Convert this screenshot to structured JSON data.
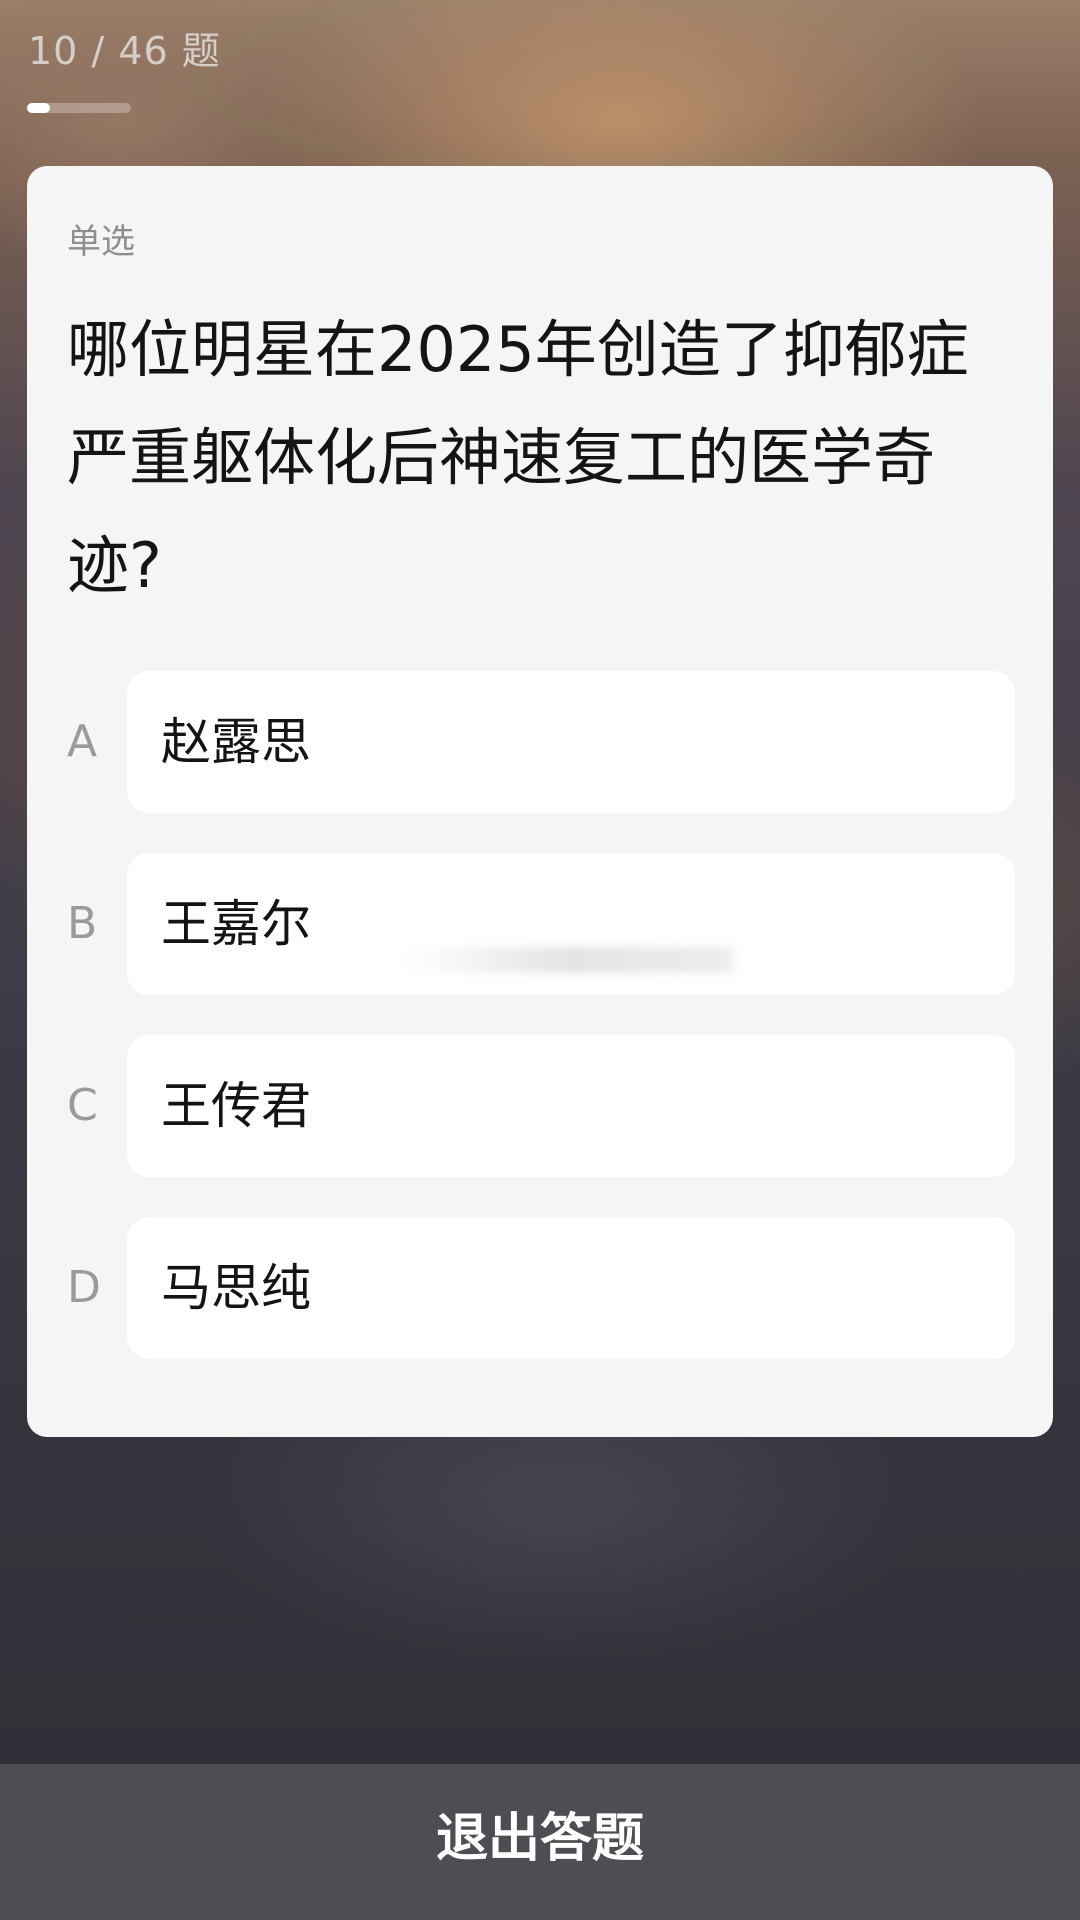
{
  "header": {
    "progress_text": "10 / 46 题",
    "progress": {
      "current": 10,
      "total": 46,
      "fraction": 0.217
    }
  },
  "question": {
    "type_label": "单选",
    "text": "哪位明星在2025年创造了抑郁症严重躯体化后神速复工的医学奇迹?",
    "options": [
      {
        "letter": "A",
        "label": "赵露思"
      },
      {
        "letter": "B",
        "label": "王嘉尔"
      },
      {
        "letter": "C",
        "label": "王传君"
      },
      {
        "letter": "D",
        "label": "马思纯"
      }
    ]
  },
  "footer": {
    "exit_label": "退出答题"
  },
  "colors": {
    "card_bg": "#f5f5f5",
    "option_bg": "#ffffff",
    "exit_bar_bg": "#4d4e54"
  }
}
